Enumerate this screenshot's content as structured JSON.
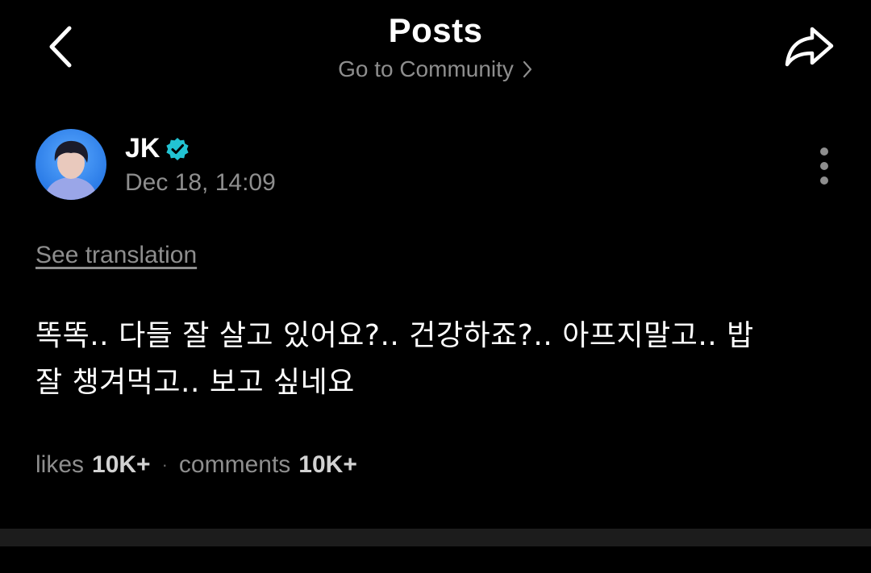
{
  "header": {
    "title": "Posts",
    "community_link": "Go to Community",
    "back_icon": "chevron-left-icon",
    "share_icon": "share-icon"
  },
  "post": {
    "author": "JK",
    "verified": true,
    "date": "Dec 18, 14:09",
    "see_translation": "See translation",
    "body_line1": "똑똑.. 다들 잘 살고 있어요?.. 건강하죠?.. 아프지말고.. 밥",
    "body_line2": "잘 챙겨먹고.. 보고 싶네요",
    "stats": {
      "likes_label": "likes",
      "likes_count": "10K+",
      "separator": "·",
      "comments_label": "comments",
      "comments_count": "10K+"
    }
  },
  "colors": {
    "background": "#000000",
    "muted_text": "#8e8e8e",
    "verified_badge": "#22c3d3",
    "divider": "#1c1c1c"
  }
}
